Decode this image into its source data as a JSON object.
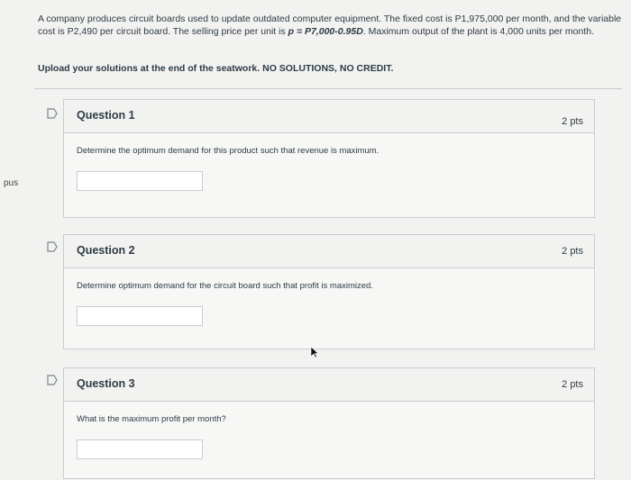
{
  "side_nav": {
    "label": "pus"
  },
  "intro": {
    "problem_start": "A company produces circuit boards used to update outdated computer equipment. The fixed cost is P1,975,000 per month, and the variable cost is P2,490 per circuit board. The selling price per unit is ",
    "price_formula": "p = P7,000-0.95D",
    "problem_end": ". Maximum output of the plant is 4,000 units per month."
  },
  "notice": "Upload your solutions at the end of the seatwork. NO SOLUTIONS, NO CREDIT.",
  "questions": [
    {
      "title": "Question 1",
      "points": "2 pts",
      "text": "Determine the optimum demand for this product such that revenue is maximum.",
      "answer": ""
    },
    {
      "title": "Question 2",
      "points": "2 pts",
      "text": "Determine optimum demand for the circuit board such that profit is maximized.",
      "answer": ""
    },
    {
      "title": "Question 3",
      "points": "2 pts",
      "text": "What is the maximum profit per month?",
      "answer": ""
    }
  ],
  "colors": {
    "border": "#c7cdd1",
    "text": "#2d3b45",
    "background": "#f2f2f0"
  },
  "icons": {
    "flag": "bookmark-flag-icon",
    "cursor": "mouse-pointer-icon"
  }
}
